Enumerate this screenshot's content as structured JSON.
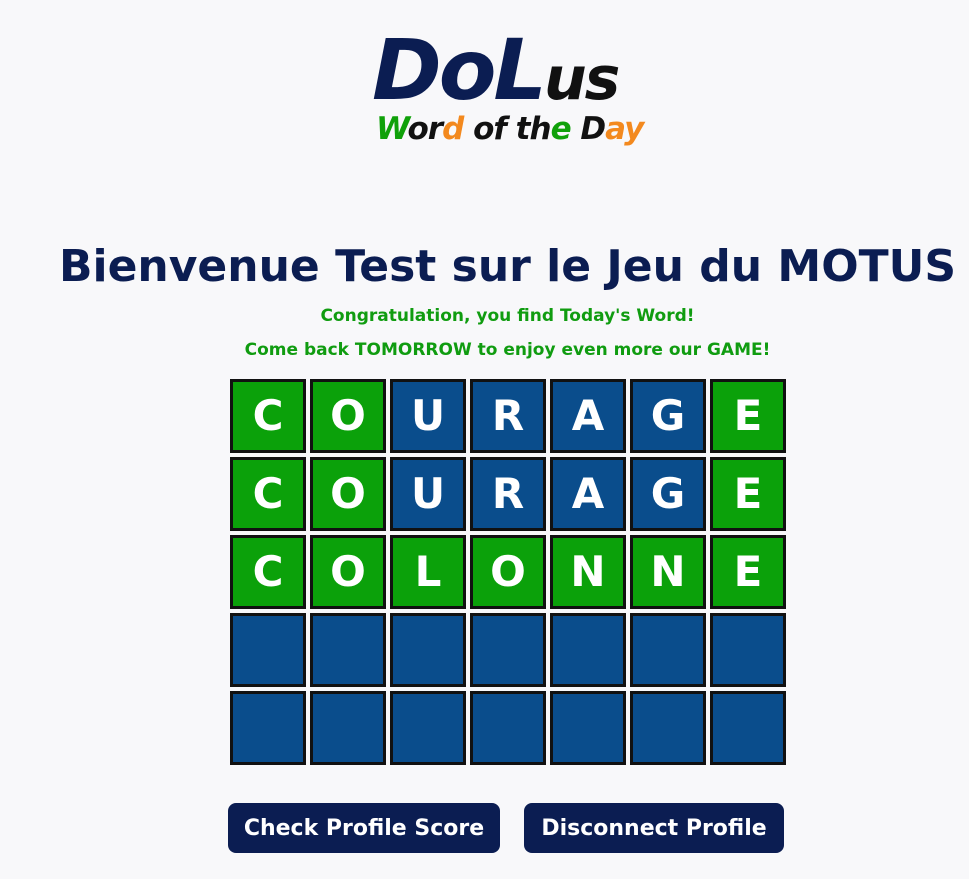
{
  "logo": {
    "main_big": "DoL",
    "main_small": "us",
    "tagline": [
      {
        "text": "W",
        "color": "green"
      },
      {
        "text": "or",
        "color": "dark"
      },
      {
        "text": "d",
        "color": "orange"
      },
      {
        "text": " of ",
        "color": "dark"
      },
      {
        "text": "th",
        "color": "dark"
      },
      {
        "text": "e",
        "color": "green"
      },
      {
        "text": " D",
        "color": "dark"
      },
      {
        "text": "ay",
        "color": "orange"
      }
    ]
  },
  "title": "Bienvenue Test sur le Jeu du MOTUS",
  "messages": {
    "line1": "Congratulation, you find Today's Word!",
    "line2": "Come back TOMORROW to enjoy even more our GAME!"
  },
  "colors": {
    "correct": "#0ba10a",
    "default": "#0a4d8c",
    "navy": "#0b1d52",
    "message": "#109c10",
    "logo_green": "#10a10a",
    "logo_orange": "#f3891e"
  },
  "grid": {
    "rows": [
      [
        {
          "letter": "C",
          "state": "correct"
        },
        {
          "letter": "O",
          "state": "correct"
        },
        {
          "letter": "U",
          "state": "absent"
        },
        {
          "letter": "R",
          "state": "absent"
        },
        {
          "letter": "A",
          "state": "absent"
        },
        {
          "letter": "G",
          "state": "absent"
        },
        {
          "letter": "E",
          "state": "correct"
        }
      ],
      [
        {
          "letter": "C",
          "state": "correct"
        },
        {
          "letter": "O",
          "state": "correct"
        },
        {
          "letter": "U",
          "state": "absent"
        },
        {
          "letter": "R",
          "state": "absent"
        },
        {
          "letter": "A",
          "state": "absent"
        },
        {
          "letter": "G",
          "state": "absent"
        },
        {
          "letter": "E",
          "state": "correct"
        }
      ],
      [
        {
          "letter": "C",
          "state": "correct"
        },
        {
          "letter": "O",
          "state": "correct"
        },
        {
          "letter": "L",
          "state": "correct"
        },
        {
          "letter": "O",
          "state": "correct"
        },
        {
          "letter": "N",
          "state": "correct"
        },
        {
          "letter": "N",
          "state": "correct"
        },
        {
          "letter": "E",
          "state": "correct"
        }
      ],
      [
        {
          "letter": "",
          "state": "empty"
        },
        {
          "letter": "",
          "state": "empty"
        },
        {
          "letter": "",
          "state": "empty"
        },
        {
          "letter": "",
          "state": "empty"
        },
        {
          "letter": "",
          "state": "empty"
        },
        {
          "letter": "",
          "state": "empty"
        },
        {
          "letter": "",
          "state": "empty"
        }
      ],
      [
        {
          "letter": "",
          "state": "empty"
        },
        {
          "letter": "",
          "state": "empty"
        },
        {
          "letter": "",
          "state": "empty"
        },
        {
          "letter": "",
          "state": "empty"
        },
        {
          "letter": "",
          "state": "empty"
        },
        {
          "letter": "",
          "state": "empty"
        },
        {
          "letter": "",
          "state": "empty"
        }
      ]
    ]
  },
  "buttons": {
    "check_score": "Check Profile Score",
    "disconnect": "Disconnect Profile"
  }
}
